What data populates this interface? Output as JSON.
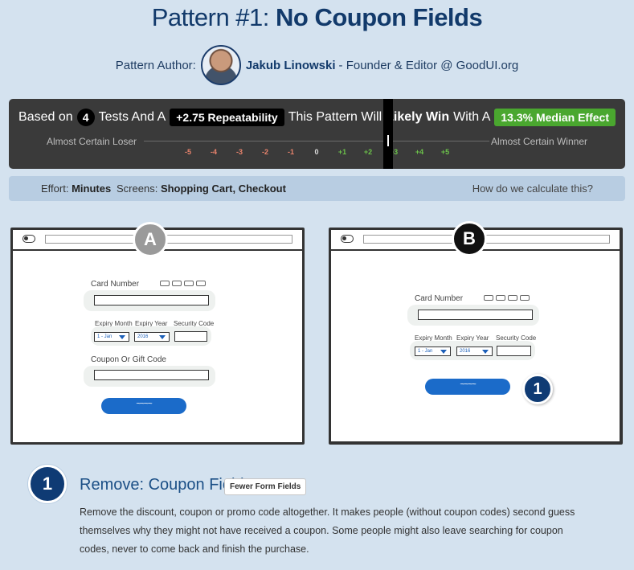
{
  "title": {
    "prefix": "Pattern #1:",
    "strong": "No Coupon Fields"
  },
  "author": {
    "label": "Pattern Author:",
    "name": "Jakub Linowski",
    "role": "- Founder & Editor @ GoodUI.org"
  },
  "result": {
    "based_on": "Based on",
    "tests_count": "4",
    "tests_and_a": "Tests And A",
    "repeatability": "+2.75 Repeatability",
    "pattern_will": "This Pattern Will",
    "likely_win": "Likely Win",
    "with_a": "With A",
    "median_effect": "13.3% Median Effect",
    "left_label": "Almost Certain Loser",
    "right_label": "Almost Certain Winner",
    "ticks": [
      "-5",
      "-4",
      "-3",
      "-2",
      "-1",
      "0",
      "+1",
      "+2",
      "+3",
      "+4",
      "+5"
    ],
    "colors": {
      "negative": "#e9836c",
      "zero": "#dddddd",
      "positive": "#6cc24a"
    }
  },
  "meta": {
    "effort_label": "Effort:",
    "effort_value": "Minutes",
    "screens_label": "Screens:",
    "screens_value": "Shopping Cart, Checkout",
    "how_link": "How do we calculate this?"
  },
  "variant_a": {
    "badge": "A",
    "card_number": "Card Number",
    "expiry_month": "Expiry Month",
    "expiry_year": "Expiry Year",
    "security_code": "Security Code",
    "month_value": "1 - Jan",
    "year_value": "2016",
    "coupon_label": "Coupon Or Gift Code"
  },
  "variant_b": {
    "badge": "B",
    "card_number": "Card Number",
    "expiry_month": "Expiry Month",
    "expiry_year": "Expiry Year",
    "security_code": "Security Code",
    "month_value": "1 - Jan",
    "year_value": "2016",
    "callout": "1"
  },
  "recommendation": {
    "number": "1",
    "title": "Remove: Coupon Fields",
    "tag": "Fewer Form Fields",
    "body": "Remove the discount, coupon or promo code altogether. It makes people (without coupon codes) second guess themselves why they might not have received a coupon. Some people might also leave searching for coupon codes, never to come back and finish the purchase."
  }
}
